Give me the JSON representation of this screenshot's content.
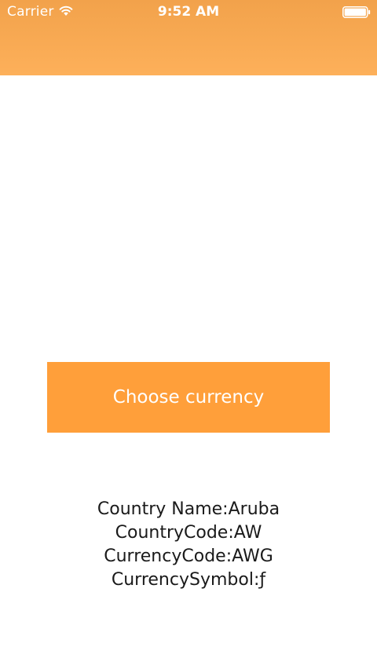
{
  "status_bar": {
    "carrier": "Carrier",
    "time": "9:52 AM",
    "wifi_icon": "wifi-icon",
    "battery_icon": "battery-icon"
  },
  "colors": {
    "header_top": "#f2a24b",
    "header_bottom": "#fdb05a",
    "button_bg": "#ff9f3a",
    "button_text": "#ffffff",
    "body_text": "#1a1a1a",
    "background": "#ffffff"
  },
  "main": {
    "choose_button_label": "Choose currency",
    "info": {
      "country_name": "Country Name:Aruba",
      "country_code": "CountryCode:AW",
      "currency_code": "CurrencyCode:AWG",
      "currency_symbol": "CurrencySymbol:ƒ"
    }
  }
}
